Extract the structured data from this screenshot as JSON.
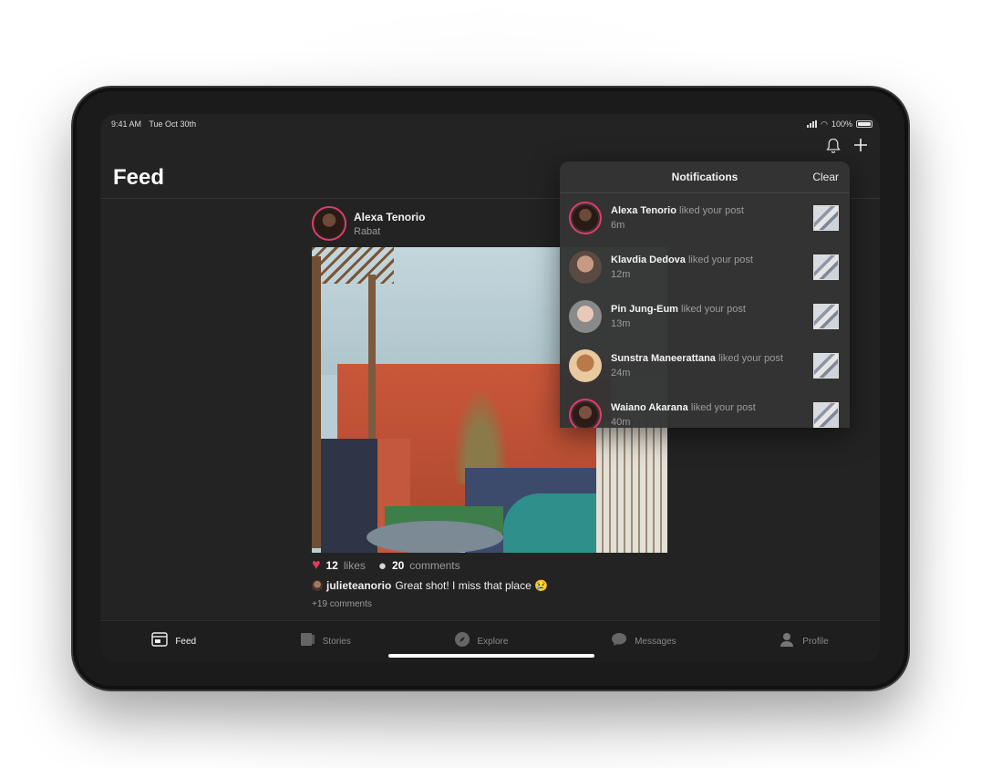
{
  "status": {
    "time": "9:41 AM",
    "date": "Tue Oct 30th",
    "battery": "100%"
  },
  "header": {
    "title": "Feed"
  },
  "post": {
    "author": "Alexa Tenorio",
    "location": "Rabat",
    "likes_count": "12",
    "likes_label": "likes",
    "comments_count": "20",
    "comments_label": "comments",
    "comment_user": "julieteanorio",
    "comment_text": "Great shot! I miss that place 😢",
    "more_comments": "+19 comments"
  },
  "notifications": {
    "title": "Notifications",
    "clear_label": "Clear",
    "items": [
      {
        "name": "Alexa Tenorio",
        "action": "liked your post",
        "time": "6m"
      },
      {
        "name": "Klavdia Dedova",
        "action": "liked your post",
        "time": "12m"
      },
      {
        "name": "Pin Jung-Eum",
        "action": "liked your post",
        "time": "13m"
      },
      {
        "name": "Sunstra Maneerattana",
        "action": "liked your post",
        "time": "24m"
      },
      {
        "name": "Waiano Akarana",
        "action": "liked your post",
        "time": "40m"
      }
    ]
  },
  "tabs": [
    {
      "label": "Feed",
      "icon": "feed-icon",
      "active": true
    },
    {
      "label": "Stories",
      "icon": "stories-icon"
    },
    {
      "label": "Explore",
      "icon": "compass-icon"
    },
    {
      "label": "Messages",
      "icon": "chat-bubble-icon"
    },
    {
      "label": "Profile",
      "icon": "person-icon"
    }
  ]
}
